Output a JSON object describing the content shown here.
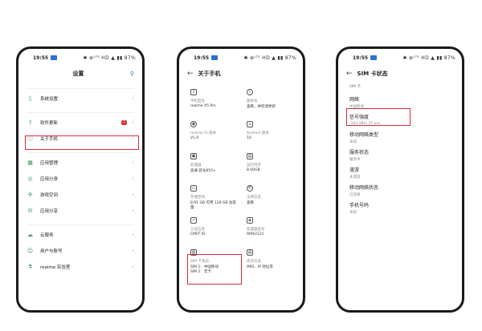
{
  "status": {
    "time": "19:55",
    "right": "✱ ⊕ᴸᵀᴱ HD ▲ ▮▮ 87%"
  },
  "screen1": {
    "title": "设置",
    "search_icon": "search-icon",
    "items": [
      {
        "icon": "phone-icon",
        "label": "系统设置"
      },
      {
        "icon": "update-icon",
        "label": "软件更新",
        "badge": "1"
      },
      {
        "icon": "info-icon",
        "label": "关于手机"
      },
      {
        "icon": "grid-icon",
        "label": "应用管理"
      },
      {
        "icon": "clone-icon",
        "label": "应用分身"
      },
      {
        "icon": "shield-icon",
        "label": "游戏空间"
      },
      {
        "icon": "share-icon",
        "label": "应用分享"
      },
      {
        "icon": "cloud-icon",
        "label": "云服务"
      },
      {
        "icon": "user-icon",
        "label": "用户与账号"
      },
      {
        "icon": "flask-icon",
        "label": "realme 实验室"
      }
    ]
  },
  "screen2": {
    "title": "关于手机",
    "cells": [
      {
        "k": "手机型号",
        "v": "realme X5 Pro"
      },
      {
        "k": "版本号",
        "v": "查看，并检测更新"
      },
      {
        "k": "realme UI 版本",
        "v": "V1.0"
      },
      {
        "k": "Android 版本",
        "v": "10"
      },
      {
        "k": "处理器",
        "v": "高通 骁龙855+"
      },
      {
        "k": "运行内存",
        "v": "8.00GB"
      },
      {
        "k": "存储空间",
        "v": "8.91 GB 可用\n128 GB 总容量"
      },
      {
        "k": "法律信息",
        "v": "查看"
      },
      {
        "k": "认证信息",
        "v": "CMIIT ID"
      },
      {
        "k": "处理器型号",
        "v": "RMX2121"
      },
      {
        "k": "SIM 卡状态",
        "v": "SIM 1：中国移动\nSIM 2：无卡"
      },
      {
        "k": "状态信息",
        "v": "IMEI、IP 地址等"
      }
    ]
  },
  "screen3": {
    "title": "SIM 卡状态",
    "head": "SIM 卡",
    "items": [
      {
        "t": "网络",
        "d": "中国移动"
      },
      {
        "t": "信号强度",
        "d": "-103 dBm 37 asu"
      },
      {
        "t": "移动网络类型",
        "d": "未知"
      },
      {
        "t": "服务状态",
        "d": "服务中"
      },
      {
        "t": "漫游",
        "d": "未漫游"
      },
      {
        "t": "移动网络状态",
        "d": "已连接"
      },
      {
        "t": "手机号码",
        "d": "未知"
      }
    ]
  },
  "colors": {
    "highlight": "#d92b3a",
    "accent": "#3a9a5e"
  }
}
